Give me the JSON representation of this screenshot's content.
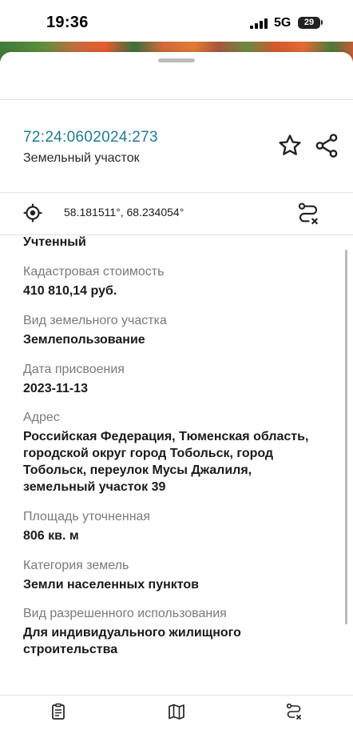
{
  "status_bar": {
    "time": "19:36",
    "network": "5G",
    "battery": "29"
  },
  "header": {
    "cadastral_number": "72:24:0602024:273",
    "object_type": "Земельный участок",
    "favorite_icon": "star-icon",
    "share_icon": "share-icon"
  },
  "location": {
    "coordinates": "58.181511°, 68.234054°",
    "locate_icon": "crosshair-icon",
    "route_icon": "route-icon"
  },
  "details": {
    "status": "Учтенный",
    "fields": [
      {
        "label": "Кадастровая стоимость",
        "value": "410 810,14 руб."
      },
      {
        "label": "Вид земельного участка",
        "value": "Землепользование"
      },
      {
        "label": "Дата присвоения",
        "value": "2023-11-13"
      },
      {
        "label": "Адрес",
        "value": "Российская Федерация, Тюменская область, городской округ город Тобольск, город Тобольск, переулок Мусы Джалиля, земельный участок 39"
      },
      {
        "label": "Площадь уточненная",
        "value": "806 кв. м"
      },
      {
        "label": "Категория земель",
        "value": "Земли населенных пунктов"
      },
      {
        "label": "Вид разрешенного использования",
        "value": "Для индивидуального жилищного строительства"
      }
    ]
  },
  "bottom_nav": {
    "items": [
      {
        "icon": "clipboard-icon"
      },
      {
        "icon": "map-icon"
      },
      {
        "icon": "route-icon"
      }
    ]
  },
  "colors": {
    "accent": "#1f7a93",
    "label_gray": "#7a7a7a",
    "text": "#1a1a1a"
  }
}
